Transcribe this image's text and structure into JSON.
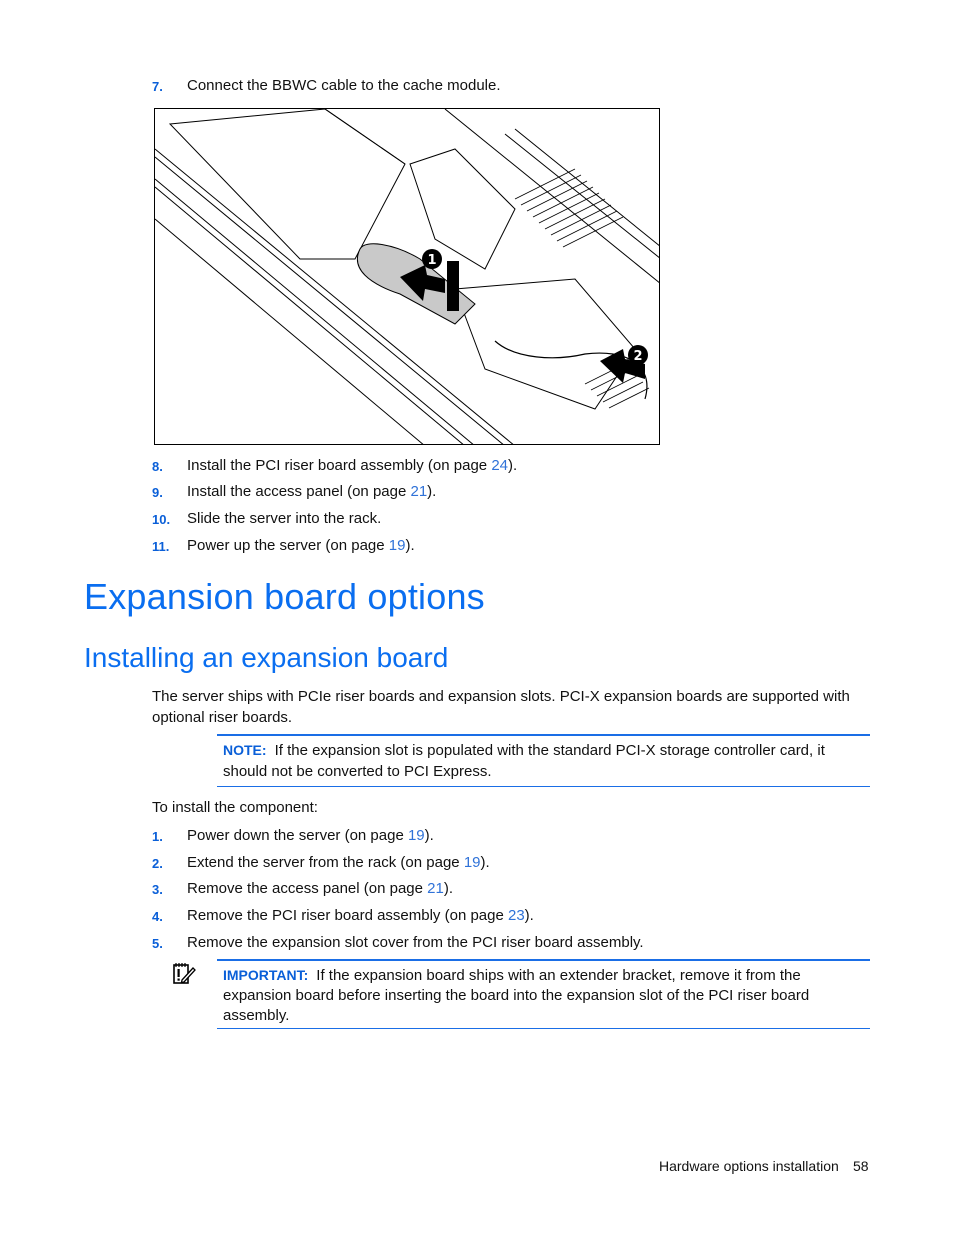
{
  "steps_top": [
    {
      "num": "7.",
      "text": "Connect the BBWC cable to the cache module.",
      "link": null,
      "suffix": ""
    }
  ],
  "figure": {
    "description": "Isometric line drawing of server interior showing BBWC battery pack and cable routing to cache module",
    "callouts": [
      "1",
      "2"
    ]
  },
  "steps_after_figure": [
    {
      "num": "8.",
      "text": "Install the PCI riser board assembly (on page ",
      "link": "24",
      "suffix": ")."
    },
    {
      "num": "9.",
      "text": "Install the access panel (on page ",
      "link": "21",
      "suffix": ")."
    },
    {
      "num": "10.",
      "text": "Slide the server into the rack.",
      "link": null,
      "suffix": ""
    },
    {
      "num": "11.",
      "text": "Power up the server (on page ",
      "link": "19",
      "suffix": ")."
    }
  ],
  "heading1": "Expansion board options",
  "heading2": "Installing an expansion board",
  "intro_paragraph": "The server ships with PCIe riser boards and expansion slots. PCI-X expansion boards are supported with optional riser boards.",
  "note": {
    "label": "NOTE:",
    "text": "If the expansion slot is populated with the standard PCI-X storage controller card, it should not be converted to PCI Express."
  },
  "procedure_intro": "To install the component:",
  "procedure_steps": [
    {
      "num": "1.",
      "text": "Power down the server (on page ",
      "link": "19",
      "suffix": ")."
    },
    {
      "num": "2.",
      "text": "Extend the server from the rack (on page ",
      "link": "19",
      "suffix": ")."
    },
    {
      "num": "3.",
      "text": "Remove the access panel (on page ",
      "link": "21",
      "suffix": ")."
    },
    {
      "num": "4.",
      "text": "Remove the PCI riser board assembly (on page ",
      "link": "23",
      "suffix": ")."
    },
    {
      "num": "5.",
      "text": "Remove the expansion slot cover from the PCI riser board assembly.",
      "link": null,
      "suffix": ""
    }
  ],
  "important": {
    "icon": "important-notepad-icon",
    "label": "IMPORTANT:",
    "text": "If the expansion board ships with an extender bracket, remove it from the expansion board before inserting the board into the expansion slot of the PCI riser board assembly."
  },
  "footer": {
    "section": "Hardware options installation",
    "page": "58"
  },
  "colors": {
    "accent_blue": "#0a6ef0",
    "link_blue": "#2f72d8"
  }
}
